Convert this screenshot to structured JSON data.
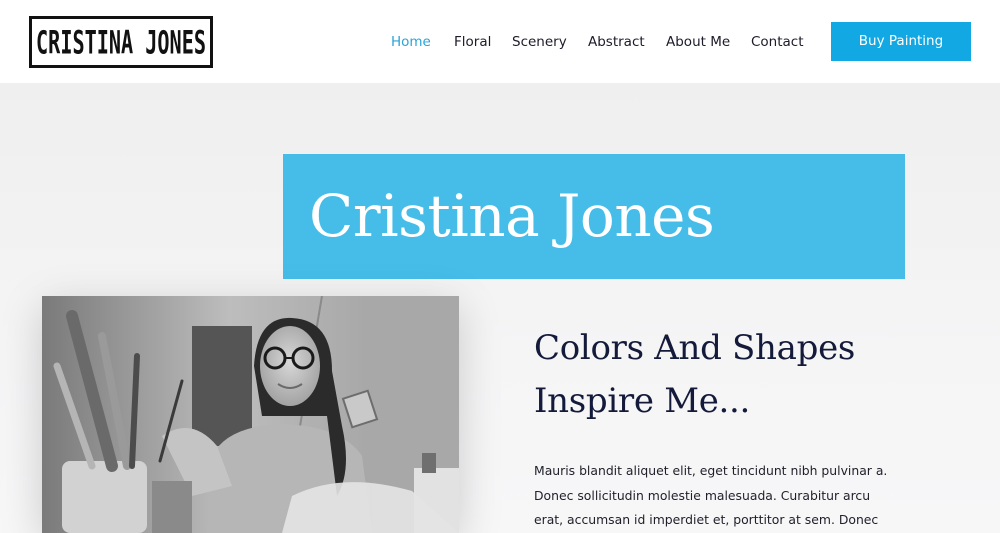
{
  "header": {
    "logo_text": "CRISTINA JONES",
    "nav": [
      {
        "label": "Home",
        "active": true
      },
      {
        "label": "Floral",
        "active": false
      },
      {
        "label": "Scenery",
        "active": false
      },
      {
        "label": "Abstract",
        "active": false
      },
      {
        "label": "About Me",
        "active": false
      },
      {
        "label": "Contact",
        "active": false
      }
    ],
    "cta_label": "Buy Painting"
  },
  "hero": {
    "title": "Cristina Jones",
    "heading_line1": "Colors And Shapes",
    "heading_line2": "Inspire Me...",
    "body": "Mauris blandit aliquet elit, eget tincidunt nibh pulvinar a. Donec sollicitudin molestie malesuada. Curabitur arcu erat, accumsan id imperdiet et, porttitor at sem. Donec"
  },
  "colors": {
    "accent": "#11a8e4",
    "title_box": "#45bde8",
    "nav_active": "#2ba3d9",
    "heading": "#141a3a",
    "page_bg": "#f2f2f3"
  },
  "icons": {
    "photo": "artist-portrait-photo"
  }
}
